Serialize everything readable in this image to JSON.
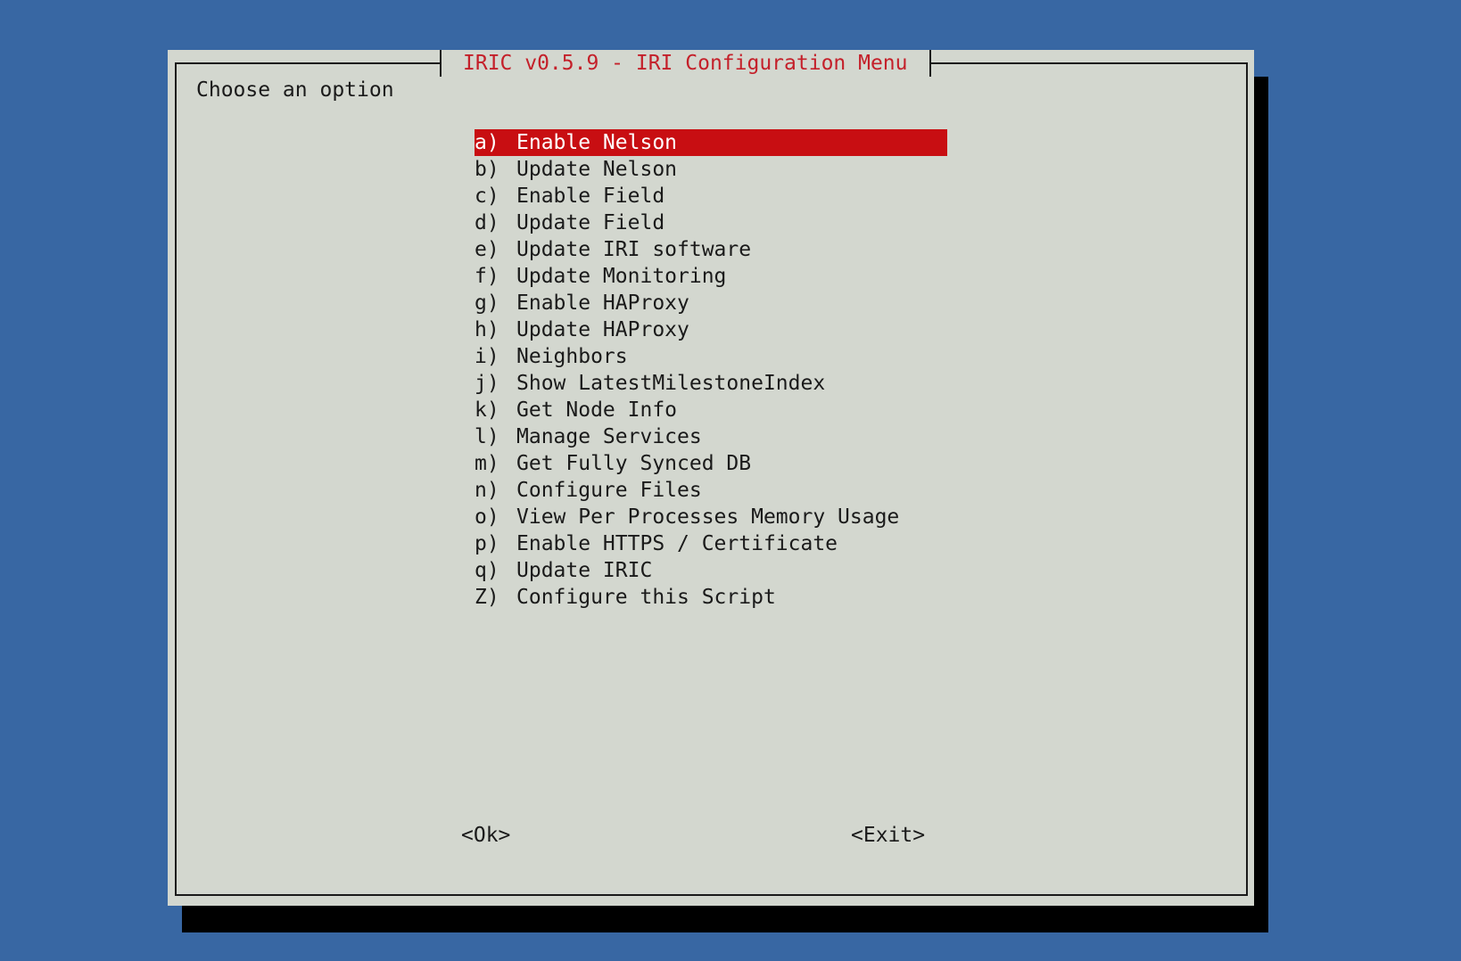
{
  "colors": {
    "desktop_background": "#3867a3",
    "dialog_background": "#d3d7cf",
    "title_text": "#c4202a",
    "selection_background": "#c80e12",
    "selection_text": "#ffffff",
    "text": "#1a1a1a"
  },
  "dialog": {
    "title": "IRIC v0.5.9 - IRI Configuration Menu",
    "prompt": "Choose an option",
    "selected_index": 0,
    "menu": [
      {
        "key": "a)",
        "label": "Enable Nelson"
      },
      {
        "key": "b)",
        "label": "Update Nelson"
      },
      {
        "key": "c)",
        "label": "Enable Field"
      },
      {
        "key": "d)",
        "label": "Update Field"
      },
      {
        "key": "e)",
        "label": "Update IRI software"
      },
      {
        "key": "f)",
        "label": "Update Monitoring"
      },
      {
        "key": "g)",
        "label": "Enable HAProxy"
      },
      {
        "key": "h)",
        "label": "Update HAProxy"
      },
      {
        "key": "i)",
        "label": "Neighbors"
      },
      {
        "key": "j)",
        "label": "Show LatestMilestoneIndex"
      },
      {
        "key": "k)",
        "label": "Get Node Info"
      },
      {
        "key": "l)",
        "label": "Manage Services"
      },
      {
        "key": "m)",
        "label": "Get Fully Synced DB"
      },
      {
        "key": "n)",
        "label": "Configure Files"
      },
      {
        "key": "o)",
        "label": "View Per Processes Memory Usage"
      },
      {
        "key": "p)",
        "label": "Enable HTTPS / Certificate"
      },
      {
        "key": "q)",
        "label": "Update IRIC"
      },
      {
        "key": "Z)",
        "label": "Configure this Script"
      }
    ],
    "buttons": {
      "ok_label": "<Ok>",
      "exit_label": "<Exit>"
    }
  }
}
